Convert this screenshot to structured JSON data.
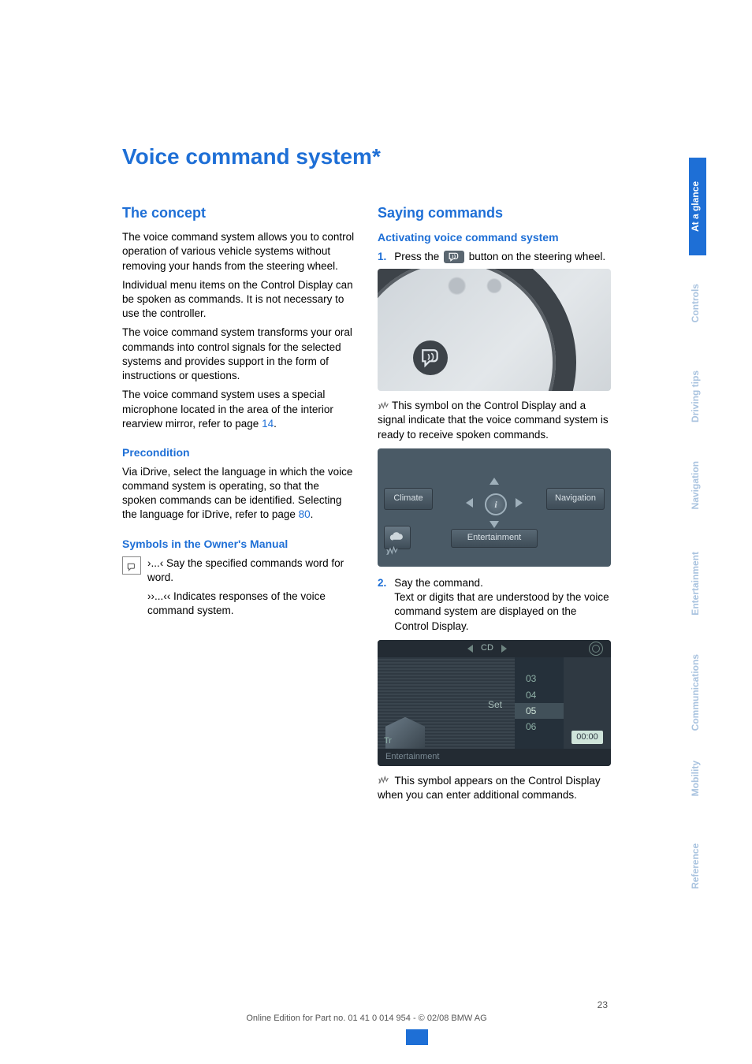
{
  "title": "Voice command system*",
  "tabs": [
    {
      "label": "At a glance",
      "active": true
    },
    {
      "label": "Controls",
      "active": false
    },
    {
      "label": "Driving tips",
      "active": false
    },
    {
      "label": "Navigation",
      "active": false
    },
    {
      "label": "Entertainment",
      "active": false
    },
    {
      "label": "Communications",
      "active": false
    },
    {
      "label": "Mobility",
      "active": false
    },
    {
      "label": "Reference",
      "active": false
    }
  ],
  "left": {
    "h2": "The concept",
    "p1": "The voice command system allows you to control operation of various vehicle systems without removing your hands from the steering wheel.",
    "p2": "Individual menu items on the Control Display can be spoken as commands. It is not necessary to use the controller.",
    "p3": "The voice command system transforms your oral commands into control signals for the selected systems and provides support in the form of instructions or questions.",
    "p4a": "The voice command system uses a special microphone located in the area of the interior rearview mirror, refer to page ",
    "p4link": "14",
    "p4b": ".",
    "h3a": "Precondition",
    "p5a": "Via iDrive, select the language in which the voice command system is operating, so that the spoken commands can be identified. Selecting the language for iDrive, refer to page ",
    "p5link": "80",
    "p5b": ".",
    "h3b": "Symbols in the Owner's Manual",
    "sym1": "›...‹ Say the specified commands word for word.",
    "sym2": "››...‹‹ Indicates responses of the voice command system."
  },
  "right": {
    "h2": "Saying commands",
    "h3a": "Activating voice command system",
    "step1a": "Press the ",
    "step1b": " button on the steering wheel.",
    "p_after_img1": "This symbol on the Control Display and a signal indicate that the voice command system is ready to receive spoken commands.",
    "menu": {
      "climate": "Climate",
      "nav": "Navigation",
      "ent": "Entertainment",
      "info": "i"
    },
    "step2_line1": "Say the command.",
    "step2_line2": "Text or digits that are understood by the voice command system are displayed on the Control Display.",
    "cd": {
      "label": "CD",
      "set": "Set",
      "tracks": [
        "03",
        "04",
        "05",
        "06"
      ],
      "tr": "Tr",
      "time": "00:00",
      "bottom": "Entertainment"
    },
    "p_after_img3": " This symbol appears on the Control Display when you can enter additional commands."
  },
  "page_number": "23",
  "footer": "Online Edition for Part no. 01 41 0 014 954  - © 02/08 BMW AG"
}
